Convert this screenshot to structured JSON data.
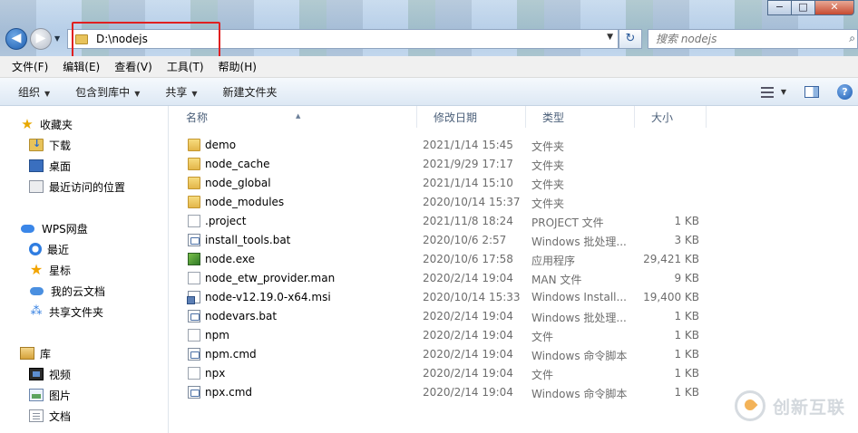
{
  "window": {
    "minimize_glyph": "−",
    "maximize_glyph": "□",
    "close_glyph": "✕"
  },
  "address_bar": {
    "path": "D:\\nodejs",
    "back_glyph": "◀",
    "forward_glyph": "▶",
    "refresh_glyph": "↻"
  },
  "search": {
    "placeholder": "搜索 nodejs"
  },
  "menubar": {
    "items": [
      "文件(F)",
      "编辑(E)",
      "查看(V)",
      "工具(T)",
      "帮助(H)"
    ]
  },
  "commandbar": {
    "items": [
      {
        "label": "组织",
        "dropdown": true
      },
      {
        "label": "包含到库中",
        "dropdown": true
      },
      {
        "label": "共享",
        "dropdown": true
      },
      {
        "label": "新建文件夹",
        "dropdown": false
      }
    ],
    "help_glyph": "?"
  },
  "sidebar": {
    "favorites": {
      "label": "收藏夹",
      "icon": "star-icon"
    },
    "favorite_items": [
      {
        "label": "下载",
        "icon": "downloads-folder-icon"
      },
      {
        "label": "桌面",
        "icon": "desktop-icon"
      },
      {
        "label": "最近访问的位置",
        "icon": "recent-places-icon"
      }
    ],
    "wps": {
      "label": "WPS网盘",
      "icon": "wps-cloud-icon"
    },
    "wps_items": [
      {
        "label": "最近",
        "icon": "clock-icon"
      },
      {
        "label": "星标",
        "icon": "star-icon"
      },
      {
        "label": "我的云文档",
        "icon": "cloud-icon"
      },
      {
        "label": "共享文件夹",
        "icon": "share-icon"
      }
    ],
    "library": {
      "label": "库",
      "icon": "library-icon"
    },
    "library_items": [
      {
        "label": "视频",
        "icon": "video-icon"
      },
      {
        "label": "图片",
        "icon": "picture-icon"
      },
      {
        "label": "文档",
        "icon": "document-icon"
      }
    ]
  },
  "filelist": {
    "columns": {
      "name": "名称",
      "date": "修改日期",
      "type": "类型",
      "size": "大小"
    },
    "rows": [
      {
        "name": "demo",
        "date": "2021/1/14 15:45",
        "type": "文件夹",
        "size": "",
        "icon": "folder"
      },
      {
        "name": "node_cache",
        "date": "2021/9/29 17:17",
        "type": "文件夹",
        "size": "",
        "icon": "folder"
      },
      {
        "name": "node_global",
        "date": "2021/1/14 15:10",
        "type": "文件夹",
        "size": "",
        "icon": "folder"
      },
      {
        "name": "node_modules",
        "date": "2020/10/14 15:37",
        "type": "文件夹",
        "size": "",
        "icon": "folder"
      },
      {
        "name": ".project",
        "date": "2021/11/8 18:24",
        "type": "PROJECT 文件",
        "size": "1 KB",
        "icon": "doc"
      },
      {
        "name": "install_tools.bat",
        "date": "2020/10/6 2:57",
        "type": "Windows 批处理...",
        "size": "3 KB",
        "icon": "bat"
      },
      {
        "name": "node.exe",
        "date": "2020/10/6 17:58",
        "type": "应用程序",
        "size": "29,421 KB",
        "icon": "exe"
      },
      {
        "name": "node_etw_provider.man",
        "date": "2020/2/14 19:04",
        "type": "MAN 文件",
        "size": "9 KB",
        "icon": "doc"
      },
      {
        "name": "node-v12.19.0-x64.msi",
        "date": "2020/10/14 15:33",
        "type": "Windows Install...",
        "size": "19,400 KB",
        "icon": "msi"
      },
      {
        "name": "nodevars.bat",
        "date": "2020/2/14 19:04",
        "type": "Windows 批处理...",
        "size": "1 KB",
        "icon": "bat"
      },
      {
        "name": "npm",
        "date": "2020/2/14 19:04",
        "type": "文件",
        "size": "1 KB",
        "icon": "doc"
      },
      {
        "name": "npm.cmd",
        "date": "2020/2/14 19:04",
        "type": "Windows 命令脚本",
        "size": "1 KB",
        "icon": "bat"
      },
      {
        "name": "npx",
        "date": "2020/2/14 19:04",
        "type": "文件",
        "size": "1 KB",
        "icon": "doc"
      },
      {
        "name": "npx.cmd",
        "date": "2020/2/14 19:04",
        "type": "Windows 命令脚本",
        "size": "1 KB",
        "icon": "bat"
      }
    ]
  },
  "watermark": {
    "text": "创新互联"
  }
}
